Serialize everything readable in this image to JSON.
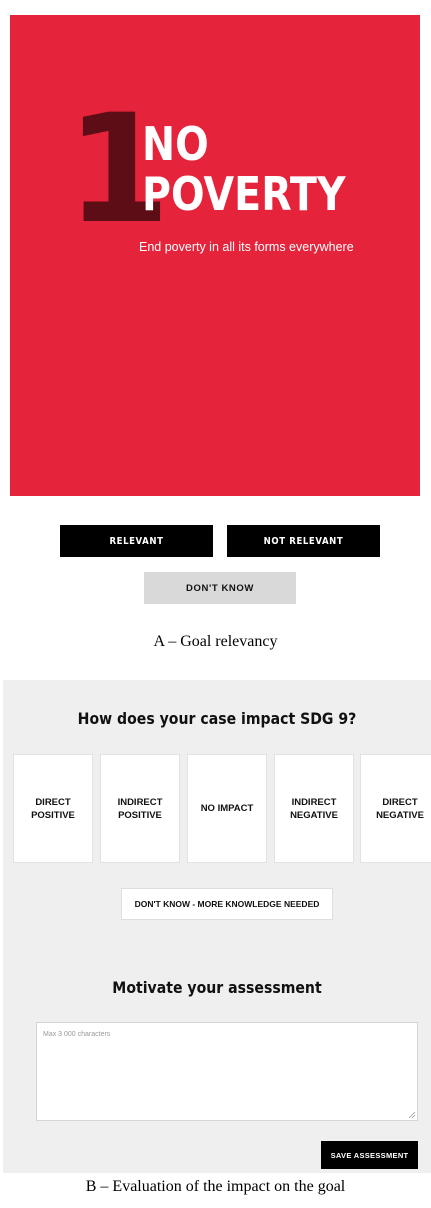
{
  "goal": {
    "number": "1",
    "title_line1": "NO",
    "title_line2": "POVERTY",
    "subtitle": "End poverty in all its forms everywhere",
    "color": "#e5243b"
  },
  "relevancy": {
    "relevant_label": "RELEVANT",
    "not_relevant_label": "NOT RELEVANT",
    "dont_know_label": "DON'T KNOW"
  },
  "captions": {
    "a": "A – Goal relevancy",
    "b": "B – Evaluation of the impact on the goal"
  },
  "impact": {
    "question": "How does your case impact SDG 9?",
    "options": [
      {
        "label": "DIRECT POSITIVE"
      },
      {
        "label": "INDIRECT POSITIVE"
      },
      {
        "label": "NO IMPACT"
      },
      {
        "label": "INDIRECT NEGATIVE"
      },
      {
        "label": "DIRECT NEGATIVE"
      }
    ],
    "dont_know_label": "DON'T KNOW - MORE KNOWLEDGE NEEDED",
    "motivate_heading": "Motivate your assessment",
    "textarea_placeholder": "Max 3 000 characters",
    "textarea_value": "",
    "save_label": "SAVE ASSESSMENT"
  }
}
